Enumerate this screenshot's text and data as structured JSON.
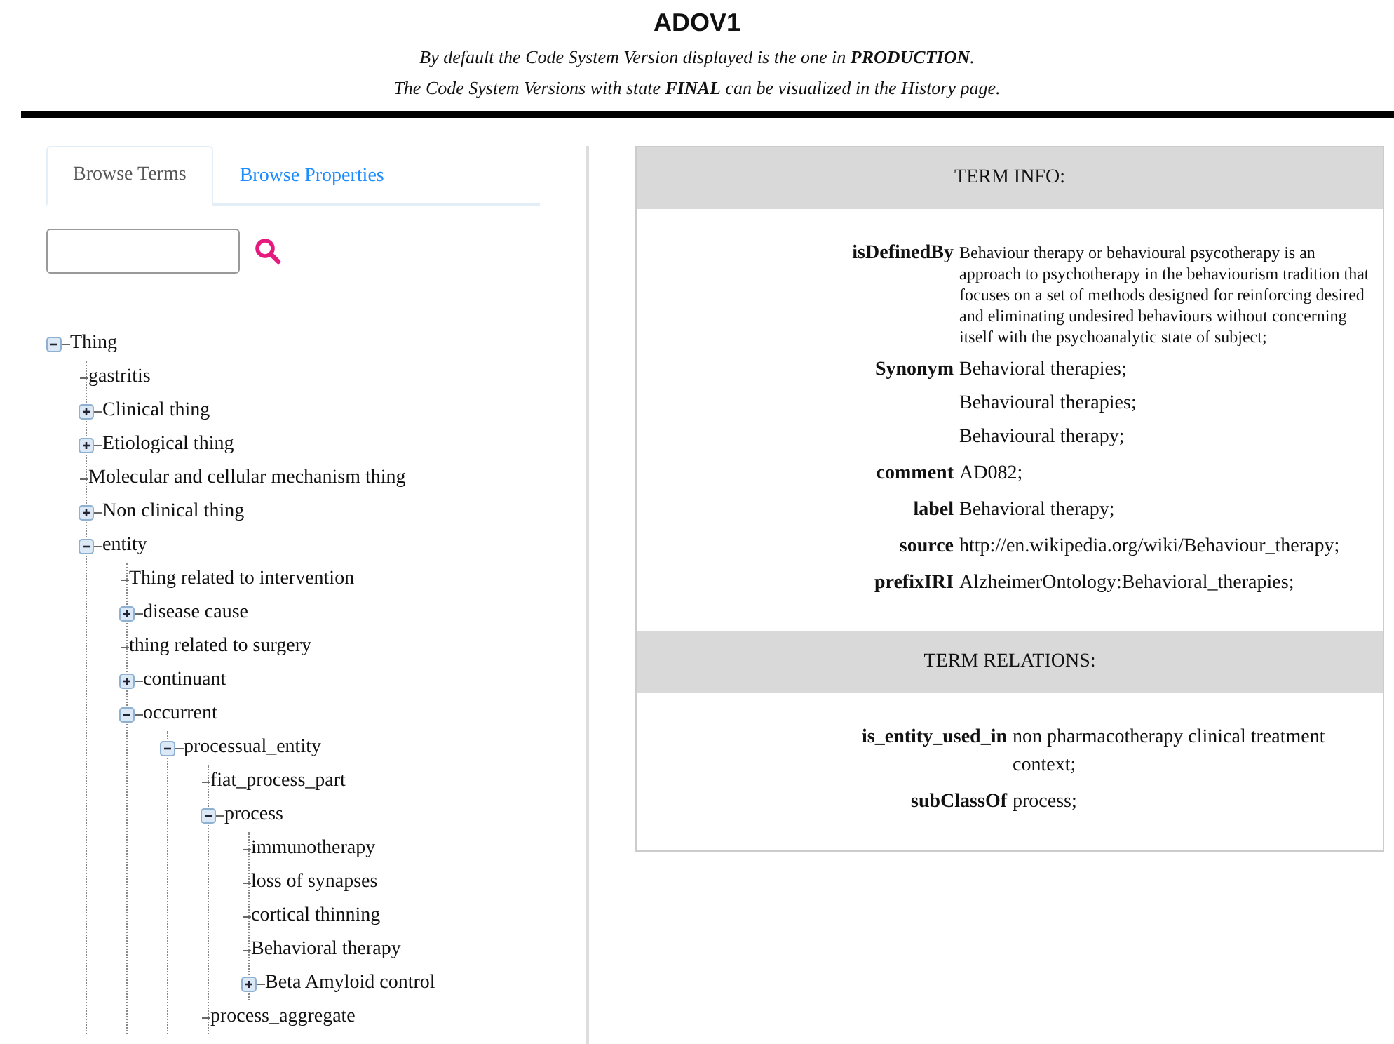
{
  "header": {
    "title": "ADOV1",
    "notes": [
      "By default the Code System Version displayed is the one in **PRODUCTION**.",
      "The Code System Versions with state **FINAL** can be visualized in the History page."
    ]
  },
  "tabs": [
    {
      "label": "Browse Terms",
      "selected": true
    },
    {
      "label": "Browse Properties",
      "selected": false
    }
  ],
  "tree": [
    {
      "label": "Thing",
      "kind": "node",
      "expanded": true,
      "children": [
        {
          "label": "gastritis",
          "kind": "leaf"
        },
        {
          "label": "Clinical thing",
          "kind": "node",
          "expanded": false
        },
        {
          "label": "Etiological thing",
          "kind": "node",
          "expanded": false
        },
        {
          "label": "Molecular and cellular mechanism thing",
          "kind": "leaf"
        },
        {
          "label": "Non clinical thing",
          "kind": "node",
          "expanded": false
        },
        {
          "label": "entity",
          "kind": "node",
          "expanded": true,
          "children": [
            {
              "label": "Thing related to intervention",
              "kind": "leaf"
            },
            {
              "label": "disease cause",
              "kind": "node",
              "expanded": false
            },
            {
              "label": "thing related to surgery",
              "kind": "leaf"
            },
            {
              "label": "continuant",
              "kind": "node",
              "expanded": false
            },
            {
              "label": "occurrent",
              "kind": "node",
              "expanded": true,
              "children": [
                {
                  "label": "processual_entity",
                  "kind": "node",
                  "expanded": true,
                  "children": [
                    {
                      "label": "fiat_process_part",
                      "kind": "leaf"
                    },
                    {
                      "label": "process",
                      "kind": "node",
                      "expanded": true,
                      "children": [
                        {
                          "label": "immunotherapy",
                          "kind": "leaf"
                        },
                        {
                          "label": "loss of synapses",
                          "kind": "leaf"
                        },
                        {
                          "label": "cortical thinning",
                          "kind": "leaf"
                        },
                        {
                          "label": "Behavioral therapy",
                          "kind": "leaf"
                        },
                        {
                          "label": "Beta Amyloid control",
                          "kind": "node",
                          "expanded": false
                        }
                      ]
                    },
                    {
                      "label": "process_aggregate",
                      "kind": "leaf"
                    }
                  ]
                }
              ]
            }
          ]
        }
      ]
    }
  ],
  "term_info": {
    "title": "TERM INFO:",
    "rows": [
      {
        "label": "isDefinedBy",
        "kind": "small",
        "values": [
          "Behaviour therapy or behavioural psycotherapy is an approach to psychotherapy in the behaviourism tradition that focuses on a set of methods designed for reinforcing desired and eliminating undesired behaviours without concerning itself with the psychoanalytic state of subject;"
        ]
      },
      {
        "label": "Synonym",
        "kind": "normal",
        "values": [
          "Behavioral therapies;",
          "Behavioural therapies;",
          "Behavioural therapy;"
        ]
      },
      {
        "label": "comment",
        "kind": "normal",
        "values": [
          "AD082;"
        ]
      },
      {
        "label": "label",
        "kind": "normal",
        "values": [
          "Behavioral therapy;"
        ]
      },
      {
        "label": "source",
        "kind": "normal",
        "values": [
          "http://en.wikipedia.org/wiki/Behaviour_therapy;"
        ]
      },
      {
        "label": "prefixIRI",
        "kind": "normal",
        "values": [
          "AlzheimerOntology:Behavioral_therapies;"
        ]
      }
    ]
  },
  "term_relations": {
    "title": "TERM RELATIONS:",
    "rows": [
      {
        "label": "is_entity_used_in",
        "values": [
          "non pharmacotherapy clinical treatment context;"
        ]
      },
      {
        "label": "subClassOf",
        "values": [
          "process;"
        ]
      }
    ]
  }
}
